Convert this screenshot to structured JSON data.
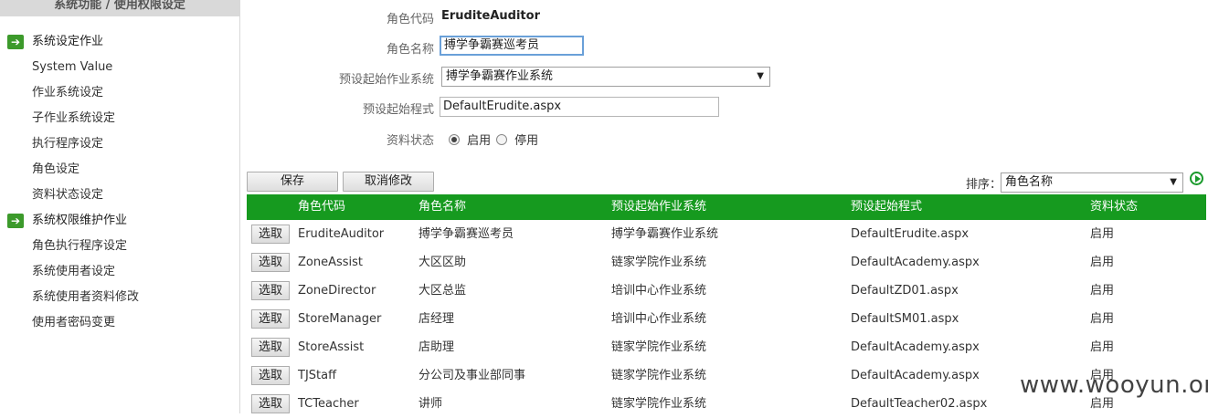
{
  "sidebar": {
    "header": "系统功能 / 使用权限设定",
    "items": [
      {
        "label": "系统设定作业",
        "group": true
      },
      {
        "label": "System Value"
      },
      {
        "label": "作业系统设定"
      },
      {
        "label": "子作业系统设定"
      },
      {
        "label": "执行程序设定"
      },
      {
        "label": "角色设定"
      },
      {
        "label": "资料状态设定"
      },
      {
        "label": "系统权限维护作业",
        "group": true
      },
      {
        "label": "角色执行程序设定"
      },
      {
        "label": "系统使用者设定"
      },
      {
        "label": "系统使用者资料修改"
      },
      {
        "label": "使用者密码变更"
      }
    ]
  },
  "form": {
    "role_code_label": "角色代码",
    "role_code_value": "EruditeAuditor",
    "role_name_label": "角色名称",
    "role_name_value": "搏学争霸赛巡考员",
    "default_system_label": "预设起始作业系统",
    "default_system_value": "搏学争霸赛作业系统",
    "default_program_label": "预设起始程式",
    "default_program_value": "DefaultErudite.aspx",
    "status_label": "资料状态",
    "status_enabled": "启用",
    "status_disabled": "停用",
    "status_selected": "启用"
  },
  "toolbar": {
    "save": "保存",
    "cancel": "取消修改",
    "sort_label": "排序：",
    "sort_value": "角色名称"
  },
  "table": {
    "headers": [
      "角色代码",
      "角色名称",
      "预设起始作业系统",
      "预设起始程式",
      "资料状态"
    ],
    "select_label": "选取",
    "rows": [
      [
        "EruditeAuditor",
        "搏学争霸赛巡考员",
        "搏学争霸赛作业系统",
        "DefaultErudite.aspx",
        "启用"
      ],
      [
        "ZoneAssist",
        "大区区助",
        "链家学院作业系统",
        "DefaultAcademy.aspx",
        "启用"
      ],
      [
        "ZoneDirector",
        "大区总监",
        "培训中心作业系统",
        "DefaultZD01.aspx",
        "启用"
      ],
      [
        "StoreManager",
        "店经理",
        "培训中心作业系统",
        "DefaultSM01.aspx",
        "启用"
      ],
      [
        "StoreAssist",
        "店助理",
        "链家学院作业系统",
        "DefaultAcademy.aspx",
        "启用"
      ],
      [
        "TJStaff",
        "分公司及事业部同事",
        "链家学院作业系统",
        "DefaultAcademy.aspx",
        "启用"
      ],
      [
        "TCTeacher",
        "讲师",
        "链家学院作业系统",
        "DefaultTeacher02.aspx",
        "启用"
      ]
    ]
  },
  "watermark": "www.wooyun.org",
  "colors": {
    "accent": "#169a1f",
    "nav_arrow": "#3c9a2b"
  }
}
